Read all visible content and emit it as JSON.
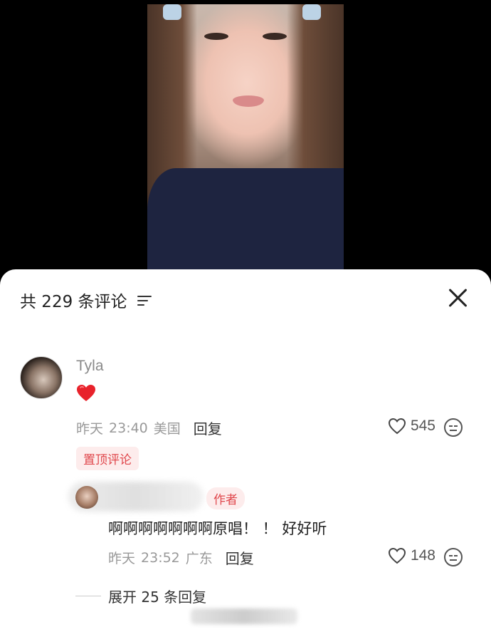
{
  "header": {
    "comment_count": "共 229 条评论"
  },
  "comment": {
    "username": "Tyla",
    "content_emoji": "heart",
    "date": "昨天",
    "time": "23:40",
    "location": "美国",
    "reply_label": "回复",
    "likes": "545",
    "pinned_label": "置顶评论"
  },
  "reply": {
    "author_badge": "作者",
    "text": "啊啊啊啊啊啊啊原唱！ ！ 好好听",
    "date": "昨天",
    "time": "23:52",
    "location": "广东",
    "reply_label": "回复",
    "likes": "148"
  },
  "expand": {
    "label": "展开 25 条回复"
  },
  "colors": {
    "accent": "#e0474c",
    "badge_bg": "#fdecec"
  }
}
